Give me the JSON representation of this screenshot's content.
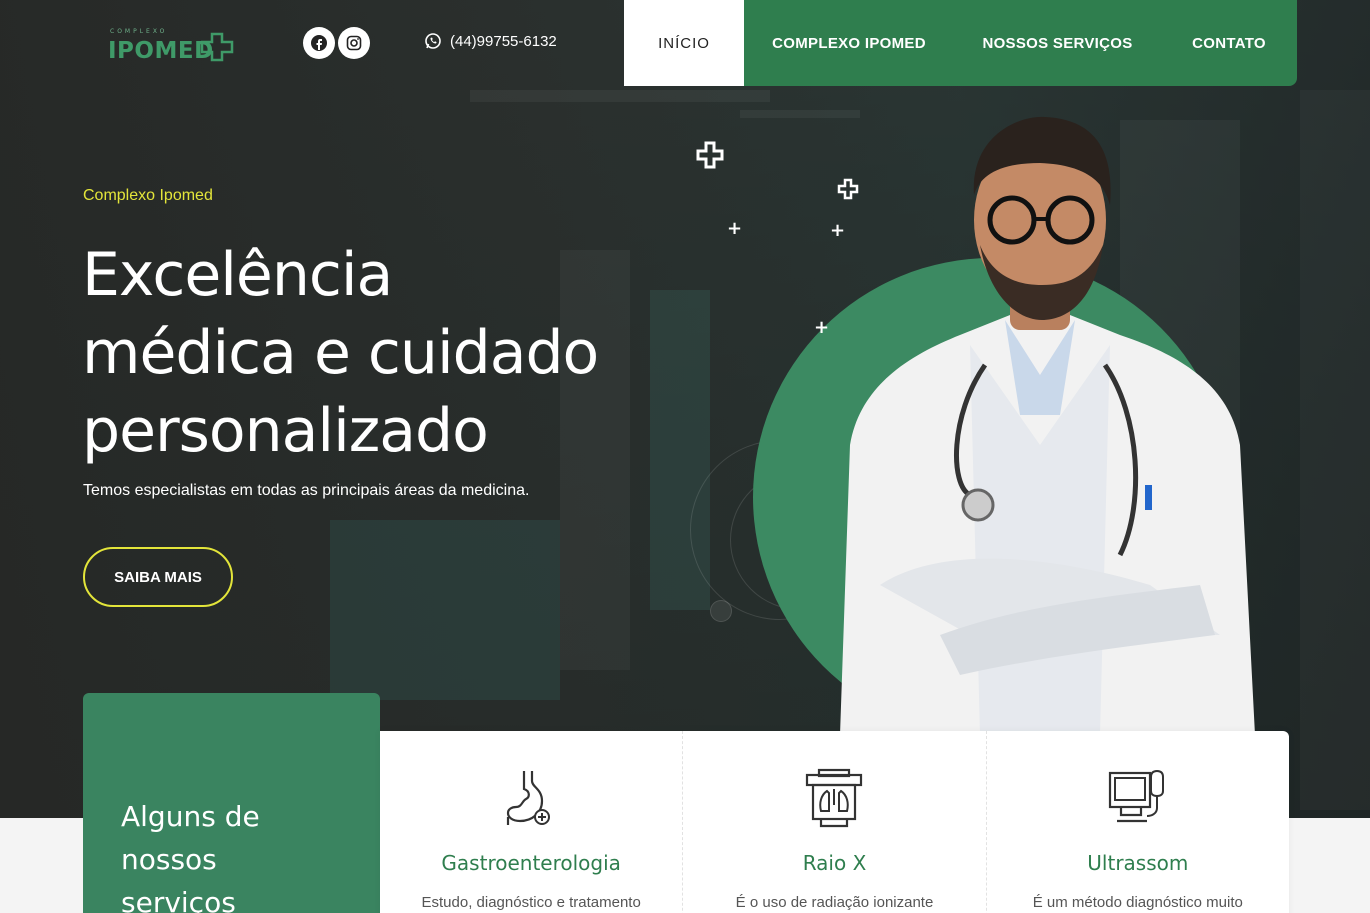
{
  "header": {
    "logo_text": "IPOMED",
    "logo_small": "COMPLEXO",
    "phone": "(44)99755-6132",
    "social": [
      {
        "name": "facebook-icon"
      },
      {
        "name": "instagram-icon"
      }
    ]
  },
  "nav": {
    "items": [
      {
        "label": "INÍCIO",
        "active": true
      },
      {
        "label": "COMPLEXO IPOMED",
        "active": false
      },
      {
        "label": "NOSSOS SERVIÇOS",
        "active": false
      },
      {
        "label": "CONTATO",
        "active": false
      }
    ]
  },
  "hero": {
    "eyebrow": "Complexo Ipomed",
    "headline_line1": "Excelência",
    "headline_line2": "médica e cuidado",
    "headline_line3": "personalizado",
    "subtitle": "Temos especialistas em todas as principais áreas da medicina.",
    "cta_label": "SAIBA MAIS"
  },
  "services": {
    "title_line1": "Alguns de",
    "title_line2": "nossos",
    "title_line3": "serviços",
    "cards": [
      {
        "title": "Gastroenterologia",
        "desc": "Estudo, diagnóstico e tratamento",
        "icon": "stomach-icon"
      },
      {
        "title": "Raio X",
        "desc": "É o uso de radiação ionizante",
        "icon": "xray-icon"
      },
      {
        "title": "Ultrassom",
        "desc": "É um método diagnóstico muito",
        "icon": "ultrasound-icon"
      }
    ]
  },
  "colors": {
    "brand_green": "#2f7e4e",
    "accent_yellow": "#e3e53a"
  }
}
